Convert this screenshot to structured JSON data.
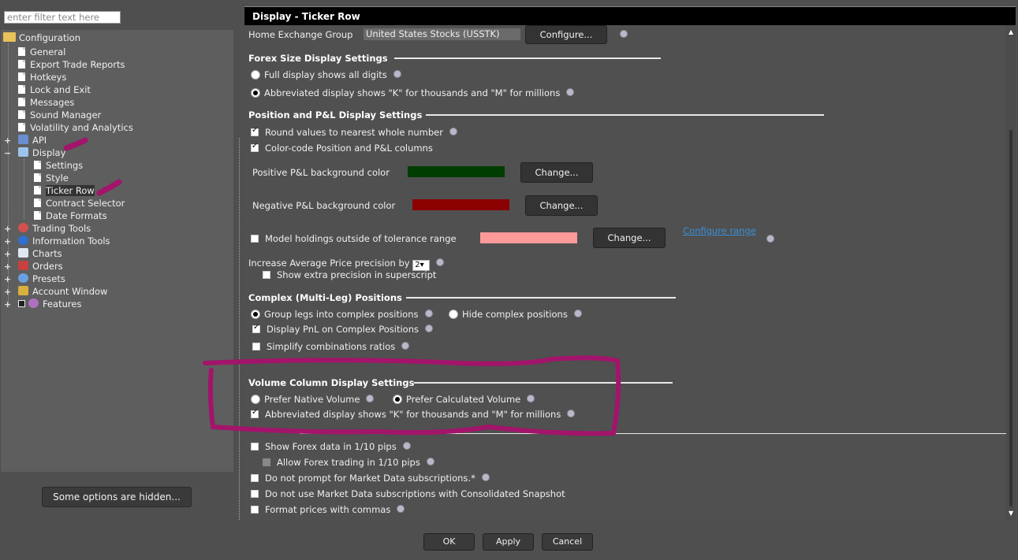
{
  "left": {
    "filter_placeholder": "enter filter text here",
    "tree": {
      "root": "Configuration",
      "items": [
        {
          "label": "General"
        },
        {
          "label": "Export Trade Reports"
        },
        {
          "label": "Hotkeys"
        },
        {
          "label": "Lock and Exit"
        },
        {
          "label": "Messages"
        },
        {
          "label": "Sound Manager"
        },
        {
          "label": "Volatility and Analytics"
        },
        {
          "label": "API"
        },
        {
          "label": "Display"
        },
        {
          "label": "Settings"
        },
        {
          "label": "Style"
        },
        {
          "label": "Ticker Row"
        },
        {
          "label": "Contract Selector"
        },
        {
          "label": "Date Formats"
        },
        {
          "label": "Trading Tools"
        },
        {
          "label": "Information Tools"
        },
        {
          "label": "Charts"
        },
        {
          "label": "Orders"
        },
        {
          "label": "Presets"
        },
        {
          "label": "Account Window"
        },
        {
          "label": "Features"
        }
      ]
    },
    "hidden_button": "Some options are hidden..."
  },
  "title": "Display - Ticker Row",
  "home_exchange": {
    "label": "Home Exchange Group",
    "value": "United States Stocks (USSTK)",
    "button": "Configure..."
  },
  "forex_size": {
    "title": "Forex Size Display Settings",
    "opt1": "Full display shows all digits",
    "opt2": "Abbreviated display shows \"K\" for thousands and \"M\" for millions"
  },
  "position_pnl": {
    "title": "Position and P&L Display Settings",
    "round": "Round values to nearest whole number",
    "color_code": "Color-code Position and P&L columns",
    "positive_label": "Positive P&L background color",
    "negative_label": "Negative P&L background color",
    "model_label": "Model holdings outside of tolerance range",
    "change": "Change...",
    "configure_range": "Configure range",
    "precision_label": "Increase Average Price precision by",
    "precision_value": "2",
    "superscript": "Show extra precision in superscript",
    "colors": {
      "positive": "#003d00",
      "negative": "#8b0000",
      "model": "#ff9a9a"
    }
  },
  "complex": {
    "title": "Complex (Multi-Leg) Positions",
    "group_legs": "Group legs into complex positions",
    "hide_complex": "Hide complex positions",
    "display_pnl": "Display PnL on Complex Positions",
    "simplify": "Simplify combinations ratios"
  },
  "volume": {
    "title": "Volume Column Display Settings",
    "native": "Prefer Native Volume",
    "calculated": "Prefer Calculated Volume",
    "abbrev": "Abbreviated display shows \"K\" for thousands and \"M\" for millions"
  },
  "market_data": {
    "forex_pips": "Show Forex data in 1/10 pips",
    "allow_forex": "Allow Forex trading in 1/10 pips",
    "no_prompt": "Do not prompt for Market Data subscriptions.*",
    "no_consolidated": "Do not use Market Data subscriptions with Consolidated Snapshot",
    "commas": "Format prices with commas"
  },
  "footer": {
    "ok": "OK",
    "apply": "Apply",
    "cancel": "Cancel"
  },
  "annotation_color": "#a3146b"
}
